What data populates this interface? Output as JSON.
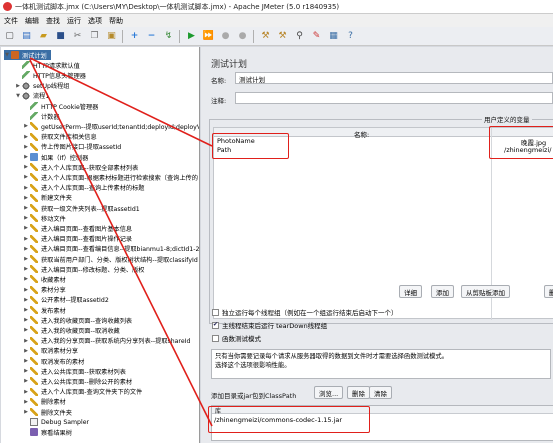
{
  "window": {
    "title": "一体机测试脚本.jmx (C:\\Users\\MY\\Desktop\\一体机测试脚本.jmx) - Apache JMeter (5.0 r1840935)"
  },
  "menu": [
    "文件",
    "编辑",
    "查找",
    "运行",
    "选项",
    "帮助"
  ],
  "toolbar": {
    "icons": [
      "new-icon",
      "templates-icon",
      "open-icon",
      "save-icon",
      "cut-icon",
      "copy-icon",
      "paste-icon",
      "expand-icon",
      "collapse-icon",
      "toggle-icon",
      "start-icon",
      "start-no-pause-icon",
      "stop-icon",
      "shutdown-icon",
      "clear-icon",
      "clear-all-icon",
      "search-icon",
      "reset-search-icon",
      "function-helper-icon",
      "help-icon"
    ]
  },
  "tree": {
    "nodes": [
      {
        "label": "测试计划",
        "icon": "plan",
        "exp": "▼",
        "selected": true
      },
      {
        "label": "HTTP请求默认值",
        "icon": "wrench",
        "exp": ""
      },
      {
        "label": "HTTP信息头管理器",
        "icon": "wrench",
        "exp": ""
      },
      {
        "label": "setUp线程组",
        "icon": "gear",
        "exp": "▶"
      },
      {
        "label": "流程1",
        "icon": "gear",
        "exp": "▼"
      },
      {
        "label": "HTTP Cookie管理器",
        "icon": "wrench",
        "exp": ""
      },
      {
        "label": "计数器",
        "icon": "wrench",
        "exp": ""
      },
      {
        "label": "getUserPerm--提取userId;tenantId;deployId;deployValu",
        "icon": "pencil",
        "exp": "▶"
      },
      {
        "label": "获取文件库相关信息",
        "icon": "pencil",
        "exp": "▶"
      },
      {
        "label": "传上传图片接口-提取assetId",
        "icon": "pencil",
        "exp": "▶"
      },
      {
        "label": "如果（If）控制器",
        "icon": "ctrl",
        "exp": "▶"
      },
      {
        "label": "进入个人库页面--获取全部素材列表",
        "icon": "pencil",
        "exp": "▶"
      },
      {
        "label": "进入个人库页面-根据素材标题进行检索搜索（查询上传的",
        "icon": "pencil",
        "exp": "▶"
      },
      {
        "label": "进入个人库页面--查询上传素材的标题",
        "icon": "pencil",
        "exp": "▶"
      },
      {
        "label": "新建文件夹",
        "icon": "pencil",
        "exp": "▶"
      },
      {
        "label": "获取一级文件夹列表--提取assetId1",
        "icon": "pencil",
        "exp": "▶"
      },
      {
        "label": "移动文件",
        "icon": "pencil",
        "exp": "▶"
      },
      {
        "label": "进入编目页面--查看图片基本信息",
        "icon": "pencil",
        "exp": "▶"
      },
      {
        "label": "进入编目页面--查看图片操作记录",
        "icon": "pencil",
        "exp": "▶"
      },
      {
        "label": "进入编目页面--查看编目信息--提取bianmu1-8;dictId1-2",
        "icon": "pencil",
        "exp": "▶"
      },
      {
        "label": "获取当前用户部门、分类、版权树状结构--提取classifyId",
        "icon": "pencil",
        "exp": "▶"
      },
      {
        "label": "进入编目页面--修改标题、分类、版权",
        "icon": "pencil",
        "exp": "▶"
      },
      {
        "label": "收藏素材",
        "icon": "pencil",
        "exp": "▶"
      },
      {
        "label": "素材分享",
        "icon": "pencil",
        "exp": "▶"
      },
      {
        "label": "公开素材--提取assetId2",
        "icon": "pencil",
        "exp": "▶"
      },
      {
        "label": "发布素材",
        "icon": "pencil",
        "exp": "▶"
      },
      {
        "label": "进入我的收藏页面--查询收藏列表",
        "icon": "pencil",
        "exp": "▶"
      },
      {
        "label": "进入我的收藏页面--取消收藏",
        "icon": "pencil",
        "exp": "▶"
      },
      {
        "label": "进入我的分享页面--获取系统内分享列表--提取shareId",
        "icon": "pencil",
        "exp": "▶"
      },
      {
        "label": "取消素材分享",
        "icon": "pencil",
        "exp": "▶"
      },
      {
        "label": "取消发布的素材",
        "icon": "pencil",
        "exp": "▶"
      },
      {
        "label": "进入公共库页面--获取素材列表",
        "icon": "pencil",
        "exp": "▶"
      },
      {
        "label": "进入公共库页面--删除公开的素材",
        "icon": "pencil",
        "exp": "▶"
      },
      {
        "label": "进入个人库页面-查询文件夹下的文件",
        "icon": "pencil",
        "exp": "▶"
      },
      {
        "label": "删除素材",
        "icon": "pencil",
        "exp": "▶"
      },
      {
        "label": "删除文件夹",
        "icon": "pencil",
        "exp": "▶"
      },
      {
        "label": "Debug Sampler",
        "icon": "debug",
        "exp": ""
      },
      {
        "label": "察看结果树",
        "icon": "listener",
        "exp": ""
      }
    ]
  },
  "panel": {
    "title": "测试计划",
    "name_label": "名称:",
    "name_value": "测试计划",
    "comment_label": "注释:",
    "comment_value": "",
    "vars_caption": "用户定义的变量",
    "vars_col_name": "名称:",
    "vars_rows": [
      {
        "name": "PhotoName",
        "value": "晚霞.jpg"
      },
      {
        "name": "Path",
        "value": "/zhinengmeizi/"
      }
    ],
    "buttons": [
      "详细",
      "添加",
      "从剪贴板添加",
      "删除"
    ],
    "check_independent": "独立运行每个线程组（例如在一个组运行结束后启动下一个）",
    "check_teardown": "主线程结束后运行 tearDown线程组",
    "check_functional": "函数测试模式",
    "note_text": "只有当你需要记录每个请求从服务器取得的数据到文件时才需要选择函数测试模式。\n选择这个选项很影响性能。",
    "classpath_label": "添加目录或jar包到ClassPath",
    "classpath_buttons": [
      "浏览...",
      "删除",
      "清除"
    ],
    "lib_header": "库",
    "lib_item": "/zhinengmeizi/commons-codec-1.15.jar"
  }
}
